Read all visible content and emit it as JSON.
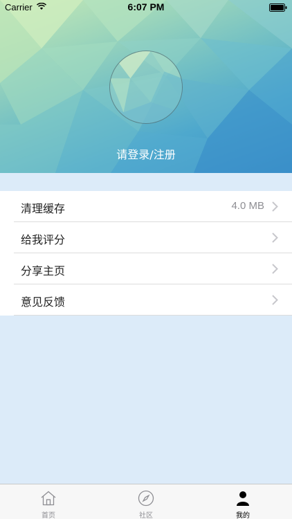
{
  "status_bar": {
    "carrier": "Carrier",
    "time": "6:07 PM"
  },
  "header": {
    "login_text": "请登录/注册"
  },
  "menu": {
    "items": [
      {
        "label": "清理缓存",
        "value": "4.0 MB"
      },
      {
        "label": "给我评分",
        "value": ""
      },
      {
        "label": "分享主页",
        "value": ""
      },
      {
        "label": "意见反馈",
        "value": ""
      }
    ]
  },
  "tabbar": {
    "tabs": [
      {
        "label": "首页",
        "icon": "home-icon",
        "active": false
      },
      {
        "label": "社区",
        "icon": "compass-icon",
        "active": false
      },
      {
        "label": "我的",
        "icon": "person-icon",
        "active": true
      }
    ]
  },
  "colors": {
    "background": "#dcebf9",
    "menu_background": "#ffffff",
    "value_text": "#8e8e93"
  }
}
